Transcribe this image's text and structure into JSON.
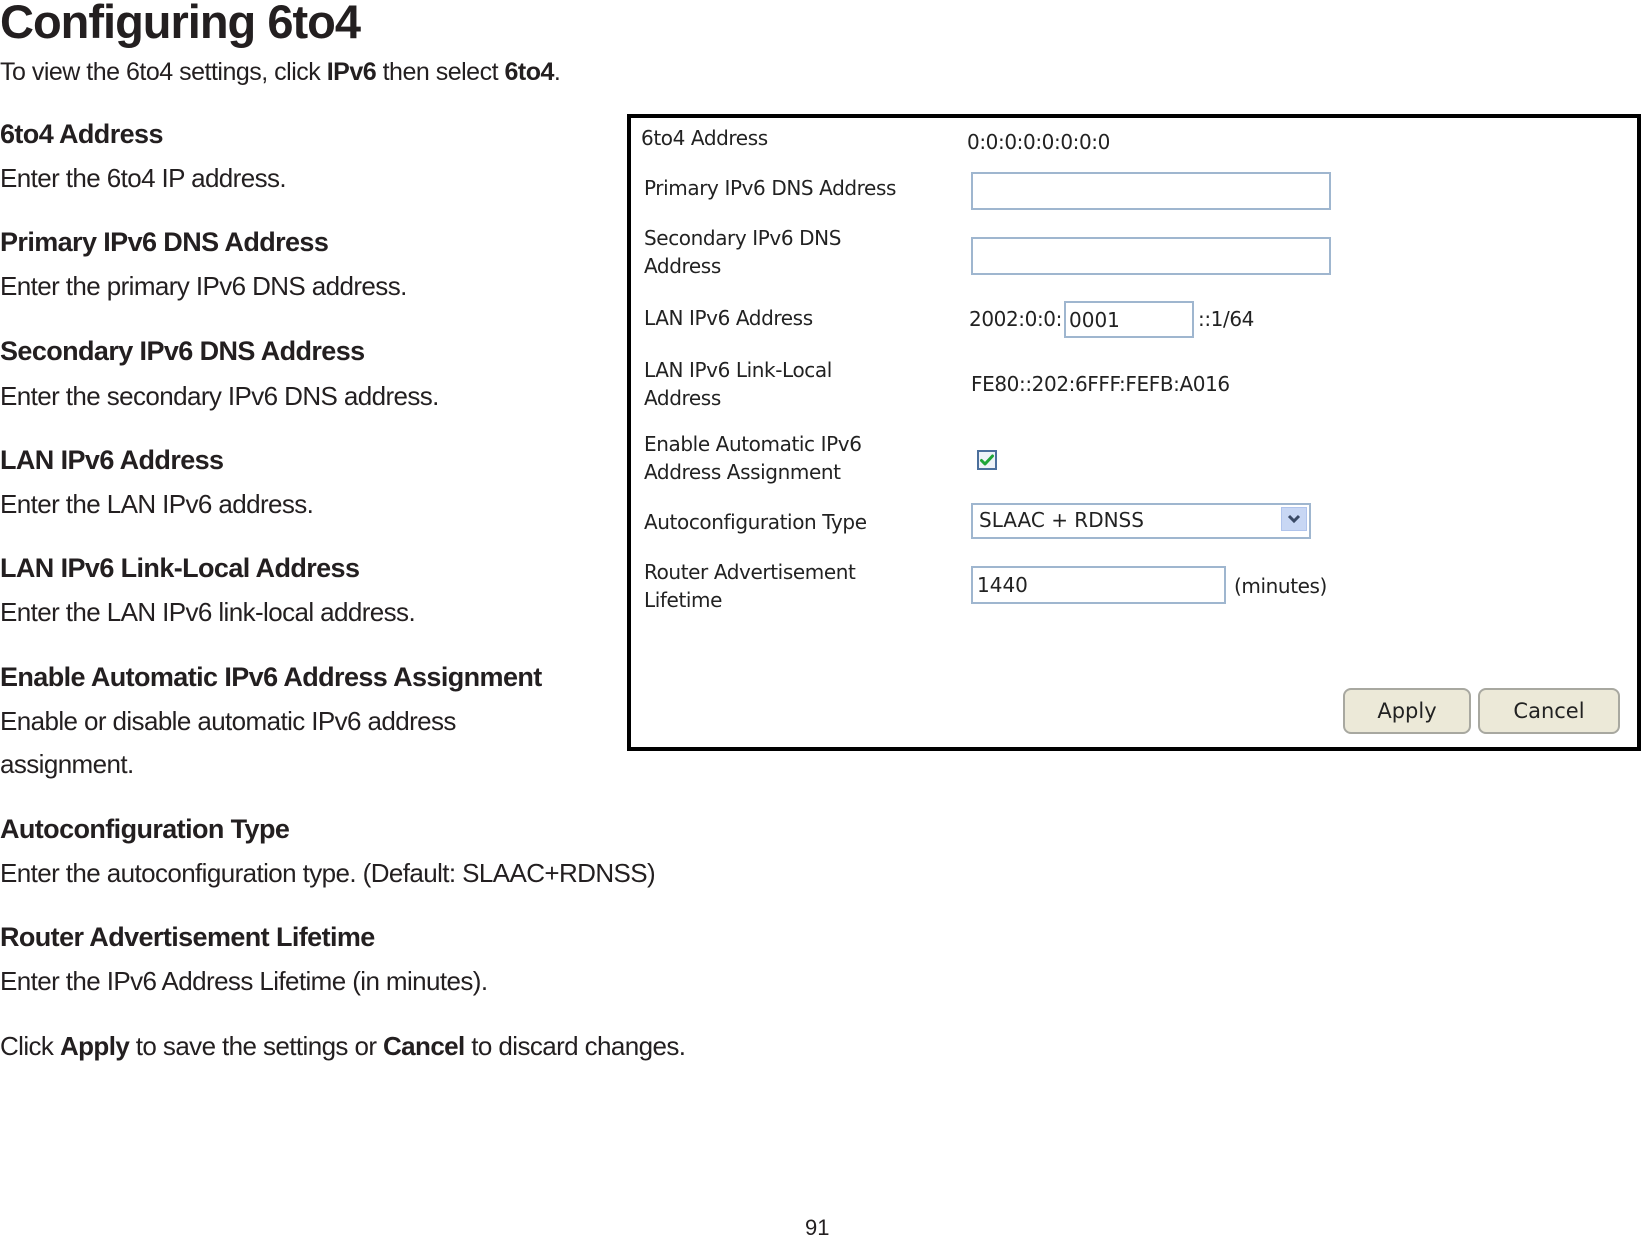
{
  "document": {
    "title": "Configuring 6to4",
    "intro": {
      "prefix": "To view the 6to4 settings, click ",
      "bold1": "IPv6",
      "middle": " then select ",
      "bold2": "6to4",
      "suffix": "."
    },
    "sections": [
      {
        "heading": "6to4 Address",
        "description": "Enter the 6to4 IP address."
      },
      {
        "heading": "Primary IPv6 DNS Address",
        "description": "Enter the primary IPv6 DNS address."
      },
      {
        "heading": "Secondary IPv6 DNS Address",
        "description": "Enter the secondary IPv6 DNS address."
      },
      {
        "heading": "LAN IPv6 Address",
        "description": "Enter the LAN IPv6 address."
      },
      {
        "heading": "LAN IPv6 Link-Local Address",
        "description": "Enter the LAN IPv6 link-local address."
      },
      {
        "heading": "Enable Automatic IPv6 Address Assignment",
        "description_line1": "Enable or disable automatic IPv6 address",
        "description_line2": "assignment."
      },
      {
        "heading": "Autoconfiguration Type",
        "description": "Enter the autoconfiguration type. (Default: SLAAC+RDNSS)"
      },
      {
        "heading": "Router Advertisement Lifetime",
        "description": "Enter the IPv6 Address Lifetime (in minutes)."
      }
    ],
    "closing": {
      "prefix": "Click ",
      "bold1": "Apply",
      "middle": " to save the settings or ",
      "bold2": "Cancel",
      "suffix": " to discard changes."
    },
    "page_number": "91"
  },
  "form": {
    "sixto4_address": {
      "label": "6to4 Address",
      "value": "0:0:0:0:0:0:0:0"
    },
    "primary_dns": {
      "label": "Primary IPv6 DNS Address",
      "value": ""
    },
    "secondary_dns": {
      "label_line1": "Secondary IPv6 DNS",
      "label_line2": "Address",
      "value": ""
    },
    "lan_ipv6": {
      "label": "LAN IPv6 Address",
      "prefix": "2002:0:0:",
      "value": "0001",
      "suffix": "::1/64"
    },
    "link_local": {
      "label_line1": "LAN IPv6 Link-Local",
      "label_line2": "Address",
      "value": "FE80::202:6FFF:FEFB:A016"
    },
    "auto_assign": {
      "label_line1": "Enable Automatic IPv6",
      "label_line2": "Address Assignment",
      "checked": true
    },
    "autoconfig_type": {
      "label": "Autoconfiguration Type",
      "selected": "SLAAC + RDNSS"
    },
    "ra_lifetime": {
      "label_line1": "Router Advertisement",
      "label_line2": "Lifetime",
      "value": "1440",
      "unit": "(minutes)"
    },
    "buttons": {
      "apply": "Apply",
      "cancel": "Cancel"
    },
    "colors": {
      "input_border": "#9fb6cf",
      "button_bg": "#ece9d8",
      "check_green": "#1fa538",
      "select_arrow_bg": "#c8d7f4"
    }
  }
}
